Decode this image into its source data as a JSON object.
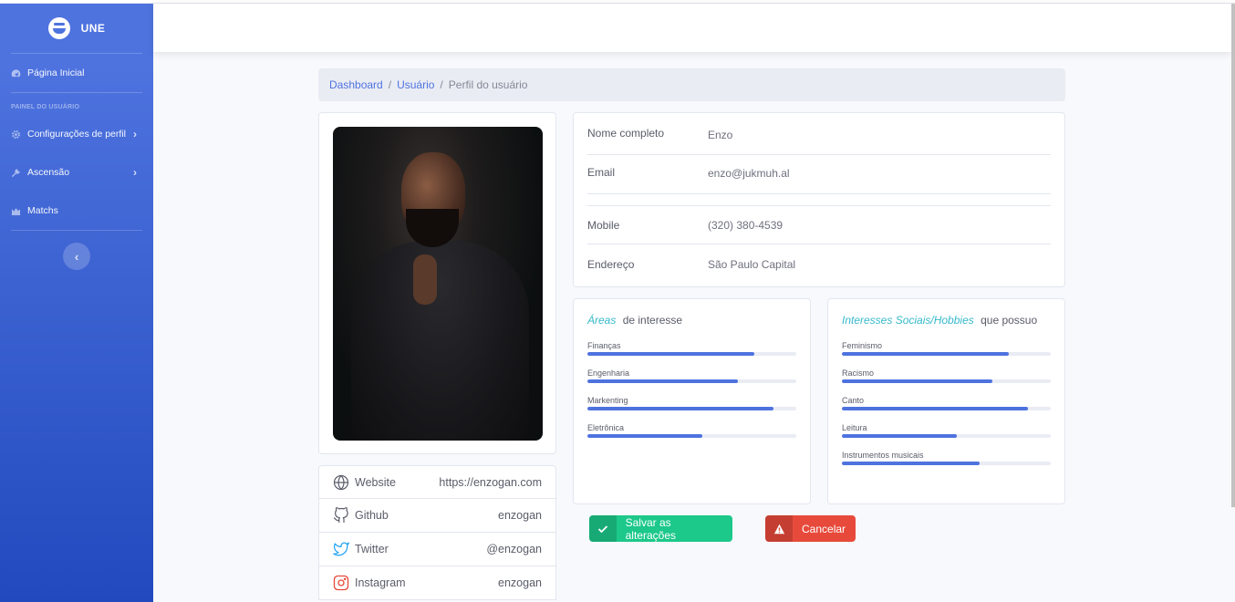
{
  "sidebar": {
    "brand": "UNE",
    "items": [
      {
        "label": "Página Inicial",
        "icon": "dashboard-icon"
      },
      {
        "label": "Configurações de perfil",
        "icon": "gear-icon"
      },
      {
        "label": "Ascensão",
        "icon": "wrench-icon"
      },
      {
        "label": "Matchs",
        "icon": "chart-area-icon"
      }
    ],
    "heading": "PAINEL DO USUÁRIO",
    "toggle_icon": "chevron-left-icon"
  },
  "breadcrumb": {
    "items": [
      "Dashboard",
      "Usuário"
    ],
    "active": "Perfil do usuário",
    "separator": "/"
  },
  "profile": {
    "links": [
      {
        "name": "Website",
        "value": "https://enzogan.com",
        "icon": "globe-icon",
        "color": "#5a5c69"
      },
      {
        "name": "Github",
        "value": "enzogan",
        "icon": "github-icon",
        "color": "#5a5c69"
      },
      {
        "name": "Twitter",
        "value": "@enzogan",
        "icon": "twitter-icon",
        "color": "#1da1f2"
      },
      {
        "name": "Instagram",
        "value": "enzogan",
        "icon": "instagram-icon",
        "color": "#e74a3b"
      }
    ],
    "info": [
      {
        "label": "Nome completo",
        "value": "Enzo"
      },
      {
        "label": "Email",
        "value": "enzo@jukmuh.al"
      },
      {
        "label": "Mobile",
        "value": "(320) 380-4539"
      },
      {
        "label": "Endereço",
        "value": "São Paulo Capital"
      }
    ]
  },
  "areas": {
    "title_highlight": "Áreas",
    "title_rest": "de interesse",
    "items": [
      {
        "label": "Finanças",
        "value": 0.8
      },
      {
        "label": "Engenharia",
        "value": 0.72
      },
      {
        "label": "Markenting",
        "value": 0.89
      },
      {
        "label": "Eletrônica",
        "value": 0.55
      }
    ]
  },
  "hobbies": {
    "title_highlight": "Interesses Sociais/Hobbies",
    "title_rest": "que possuo",
    "items": [
      {
        "label": "Feminismo",
        "value": 0.8
      },
      {
        "label": "Racismo",
        "value": 0.72
      },
      {
        "label": "Canto",
        "value": 0.89
      },
      {
        "label": "Leitura",
        "value": 0.55
      },
      {
        "label": "Instrumentos musicais",
        "value": 0.66
      }
    ]
  },
  "actions": {
    "save": "Salvar as alterações",
    "save_icon": "check-icon",
    "cancel": "Cancelar",
    "cancel_icon": "warning-icon"
  },
  "colors": {
    "primary": "#4e73df",
    "success": "#1cc88a",
    "danger": "#e74a3b",
    "info": "#36b9cc"
  }
}
